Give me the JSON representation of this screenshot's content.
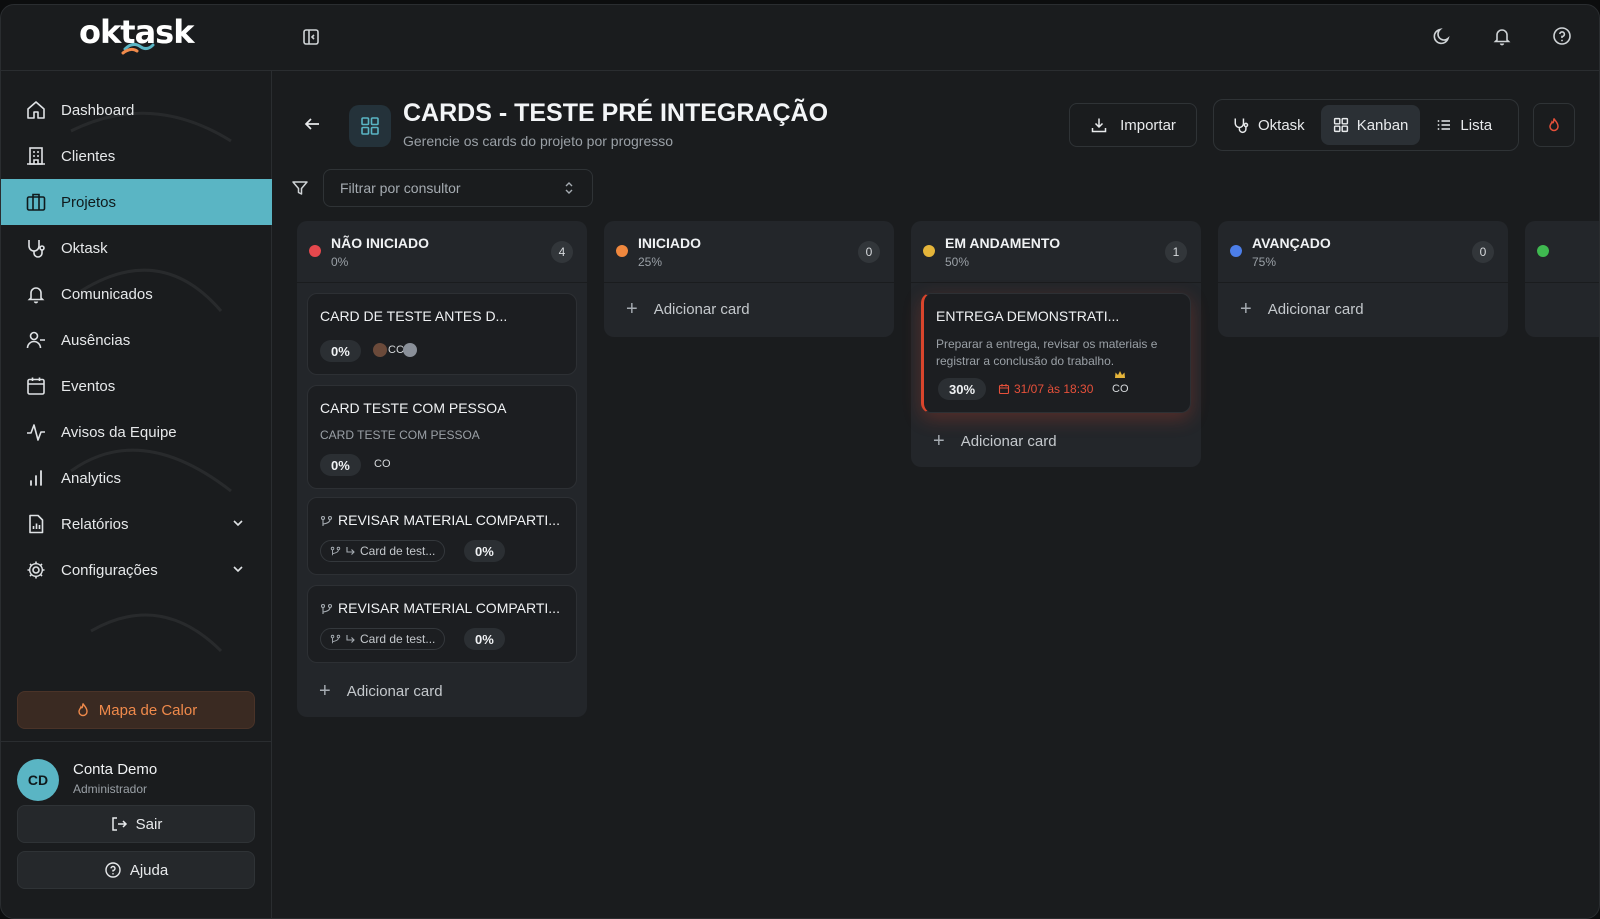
{
  "app": {
    "logo": "oktask"
  },
  "sidebar": {
    "items": [
      {
        "label": "Dashboard",
        "icon": "home-icon"
      },
      {
        "label": "Clientes",
        "icon": "building-icon"
      },
      {
        "label": "Projetos",
        "icon": "briefcase-icon",
        "active": true
      },
      {
        "label": "Oktask",
        "icon": "stethoscope-icon"
      },
      {
        "label": "Comunicados",
        "icon": "bell-icon"
      },
      {
        "label": "Ausências",
        "icon": "user-minus-icon"
      },
      {
        "label": "Eventos",
        "icon": "calendar-icon"
      },
      {
        "label": "Avisos da Equipe",
        "icon": "activity-icon"
      },
      {
        "label": "Analytics",
        "icon": "bar-chart-icon"
      },
      {
        "label": "Relatórios",
        "icon": "report-icon",
        "expandable": true
      },
      {
        "label": "Configurações",
        "icon": "gear-icon",
        "expandable": true
      }
    ],
    "heatmap_label": "Mapa de Calor",
    "user": {
      "initials": "CD",
      "name": "Conta Demo",
      "role": "Administrador"
    },
    "logout_label": "Sair",
    "help_label": "Ajuda"
  },
  "header": {
    "title": "CARDS - TESTE PRÉ INTEGRAÇÃO",
    "subtitle": "Gerencie os cards do projeto por progresso",
    "import_label": "Importar",
    "views": [
      {
        "label": "Oktask",
        "active": false
      },
      {
        "label": "Kanban",
        "active": true
      },
      {
        "label": "Lista",
        "active": false
      }
    ]
  },
  "filter": {
    "placeholder": "Filtrar por consultor"
  },
  "board": {
    "add_label": "Adicionar card",
    "columns": [
      {
        "title": "NÃO INICIADO",
        "pct": "0%",
        "count": "4",
        "color": "#e5484d",
        "cards": [
          {
            "title": "CARD DE TESTE ANTES D...",
            "pct": "0%",
            "assignee": "CC"
          },
          {
            "title": "CARD TESTE COM PESSOA",
            "desc": "CARD TESTE COM PESSOA",
            "pct": "0%",
            "assignee": "CO"
          },
          {
            "title": "REVISAR MATERIAL COMPARTI...",
            "parent": "Card de test...",
            "pct": "0%"
          },
          {
            "title": "REVISAR MATERIAL COMPARTI...",
            "parent": "Card de test...",
            "pct": "0%"
          }
        ]
      },
      {
        "title": "INICIADO",
        "pct": "25%",
        "count": "0",
        "color": "#f0883e",
        "cards": []
      },
      {
        "title": "EM ANDAMENTO",
        "pct": "50%",
        "count": "1",
        "color": "#e5b53a",
        "cards": [
          {
            "title": "ENTREGA DEMONSTRATI...",
            "desc": "Preparar a entrega, revisar os materiais e registrar a conclusão do trabalho.",
            "pct": "30%",
            "due": "31/07 às 18:30",
            "assignee": "CO"
          }
        ]
      },
      {
        "title": "AVANÇADO",
        "pct": "75%",
        "count": "0",
        "color": "#4c7ee8",
        "cards": []
      },
      {
        "title": "",
        "pct": "",
        "count": "",
        "color": "#3fb950",
        "cards": []
      }
    ]
  }
}
